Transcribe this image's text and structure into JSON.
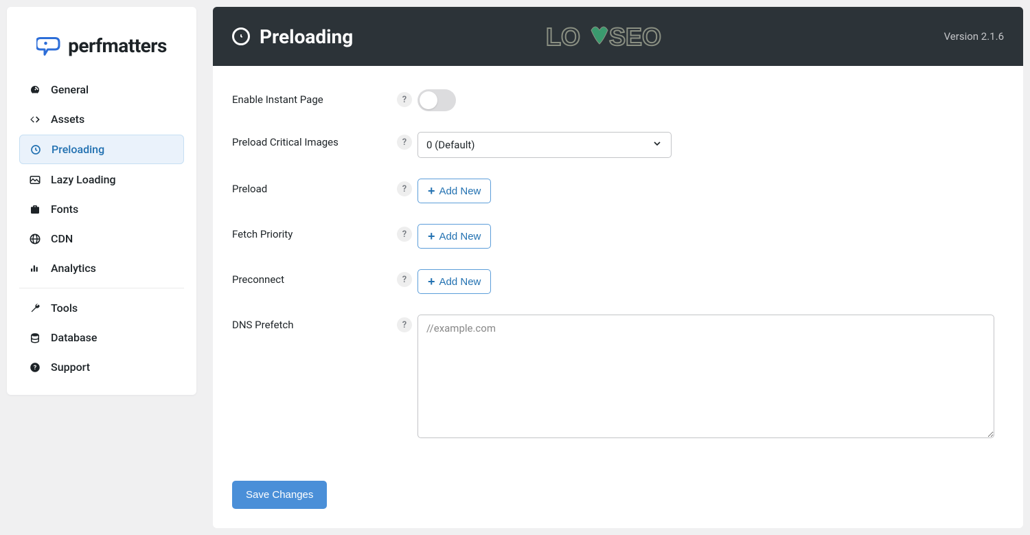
{
  "brand": {
    "text": "perfmatters"
  },
  "nav": [
    {
      "id": "general",
      "label": "General"
    },
    {
      "id": "assets",
      "label": "Assets"
    },
    {
      "id": "preloading",
      "label": "Preloading",
      "active": true
    },
    {
      "id": "lazyloading",
      "label": "Lazy Loading"
    },
    {
      "id": "fonts",
      "label": "Fonts"
    },
    {
      "id": "cdn",
      "label": "CDN"
    },
    {
      "id": "analytics",
      "label": "Analytics"
    }
  ],
  "nav2": [
    {
      "id": "tools",
      "label": "Tools"
    },
    {
      "id": "database",
      "label": "Database"
    },
    {
      "id": "support",
      "label": "Support"
    }
  ],
  "header": {
    "title": "Preloading",
    "version": "Version 2.1.6",
    "watermark": "LOYSEO"
  },
  "fields": {
    "instant_page": {
      "label": "Enable Instant Page",
      "value": false
    },
    "critical_images": {
      "label": "Preload Critical Images",
      "selected": "0 (Default)"
    },
    "preload": {
      "label": "Preload",
      "button": "Add New"
    },
    "fetch_priority": {
      "label": "Fetch Priority",
      "button": "Add New"
    },
    "preconnect": {
      "label": "Preconnect",
      "button": "Add New"
    },
    "dns_prefetch": {
      "label": "DNS Prefetch",
      "placeholder": "//example.com",
      "value": ""
    },
    "help_symbol": "?"
  },
  "actions": {
    "save": "Save Changes"
  }
}
